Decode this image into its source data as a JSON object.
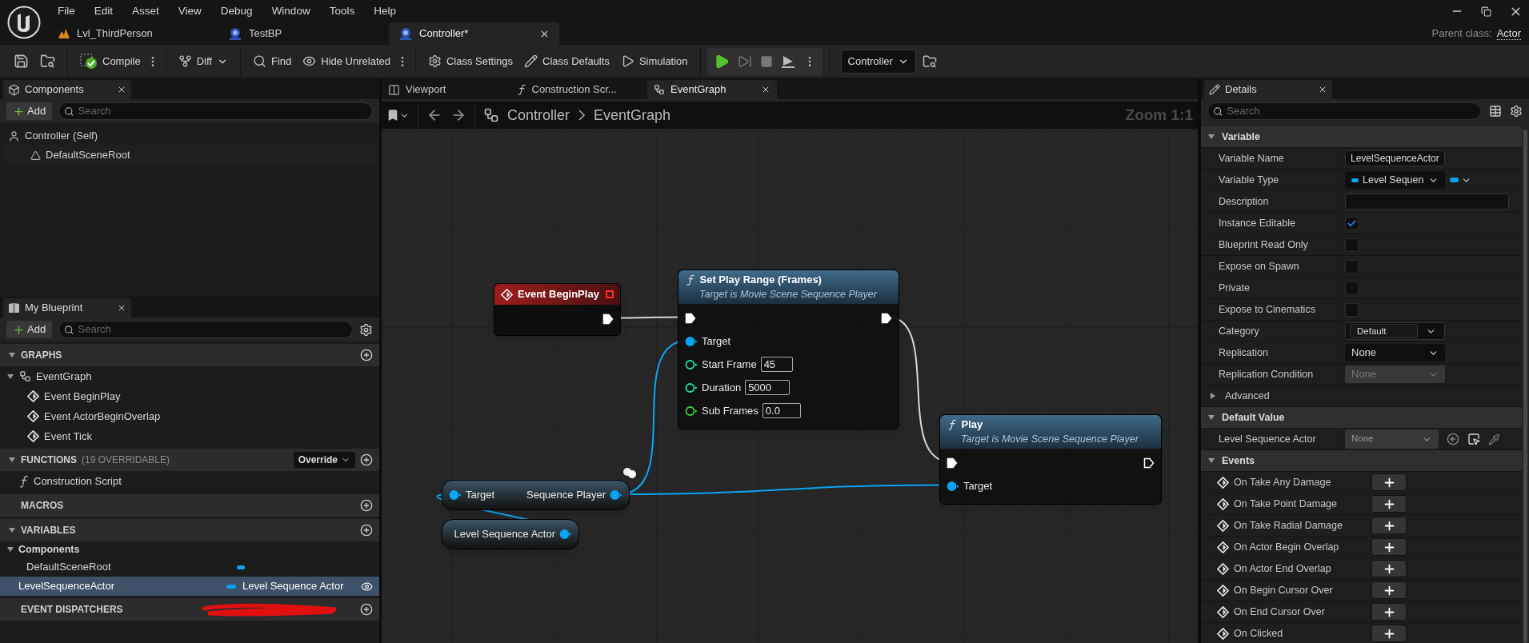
{
  "menu": [
    "File",
    "Edit",
    "Asset",
    "View",
    "Debug",
    "Window",
    "Tools",
    "Help"
  ],
  "document_tabs": [
    {
      "label": "Lvl_ThirdPerson",
      "kind": "level",
      "selected": false
    },
    {
      "label": "TestBP",
      "kind": "blueprint",
      "selected": false
    },
    {
      "label": "Controller*",
      "kind": "blueprint",
      "selected": true
    }
  ],
  "parent_class": {
    "label": "Parent class:",
    "value": "Actor"
  },
  "toolbar": {
    "compile": "Compile",
    "diff": "Diff",
    "find": "Find",
    "hide_unrelated": "Hide Unrelated",
    "class_settings": "Class Settings",
    "class_defaults": "Class Defaults",
    "simulation": "Simulation",
    "debug_object": "Controller"
  },
  "components": {
    "title": "Components",
    "add": "Add",
    "search_placeholder": "Search",
    "tree": [
      {
        "label": "Controller (Self)",
        "children": [
          {
            "label": "DefaultSceneRoot"
          }
        ]
      }
    ]
  },
  "my_blueprint": {
    "title": "My Blueprint",
    "add": "Add",
    "search_placeholder": "Search",
    "graphs": {
      "title": "GRAPHS",
      "expanded": true,
      "items": [
        {
          "label": "EventGraph",
          "expanded": true,
          "children": [
            {
              "label": "Event BeginPlay"
            },
            {
              "label": "Event ActorBeginOverlap"
            },
            {
              "label": "Event Tick"
            }
          ]
        }
      ]
    },
    "functions": {
      "title": "FUNCTIONS",
      "note": "(19 OVERRIDABLE)",
      "override": "Override",
      "expanded": true,
      "items": [
        {
          "label": "Construction Script"
        }
      ]
    },
    "macros": {
      "title": "MACROS"
    },
    "variables": {
      "title": "VARIABLES",
      "expanded": true,
      "categories": [
        {
          "label": "Components",
          "expanded": true,
          "items": [
            {
              "name": "DefaultSceneRoot",
              "selected": false
            }
          ]
        }
      ],
      "items": [
        {
          "name": "LevelSequenceActor",
          "type": "Level Sequence Actor",
          "selected": true
        }
      ]
    },
    "event_dispatchers": {
      "title": "EVENT DISPATCHERS"
    }
  },
  "graph_editor": {
    "tabs": [
      {
        "label": "Viewport",
        "kind": "viewport",
        "selected": false
      },
      {
        "label": "Construction Scr...",
        "kind": "function",
        "selected": false
      },
      {
        "label": "EventGraph",
        "kind": "graph",
        "selected": true
      }
    ],
    "breadcrumb": [
      "Controller",
      "EventGraph"
    ],
    "zoom": "Zoom 1:1",
    "nodes": [
      {
        "kind": "event",
        "title": "Event BeginPlay",
        "outputs": [
          {
            "kind": "exec",
            "connected": true
          }
        ]
      },
      {
        "kind": "function",
        "title": "Set Play Range (Frames)",
        "subtitle": "Target is Movie Scene Sequence Player",
        "inputs": [
          {
            "kind": "exec",
            "connected": true
          },
          {
            "kind": "object",
            "label": "Target",
            "connected": true
          },
          {
            "kind": "int",
            "label": "Start Frame",
            "value": "45",
            "connected": false
          },
          {
            "kind": "int",
            "label": "Duration",
            "value": "5000",
            "connected": false
          },
          {
            "kind": "float",
            "label": "Sub Frames",
            "value": "0.0",
            "connected": false
          }
        ],
        "outputs": [
          {
            "kind": "exec",
            "connected": true
          }
        ]
      },
      {
        "kind": "function",
        "title": "Play",
        "subtitle": "Target is Movie Scene Sequence Player",
        "inputs": [
          {
            "kind": "exec",
            "connected": true
          },
          {
            "kind": "object",
            "label": "Target",
            "connected": true
          }
        ],
        "outputs": [
          {
            "kind": "exec",
            "connected": false
          }
        ]
      },
      {
        "kind": "pure",
        "inputs": [
          {
            "kind": "object",
            "label": "Target",
            "connected": true
          }
        ],
        "outputs": [
          {
            "kind": "object",
            "label": "Sequence Player",
            "connected": true
          }
        ]
      },
      {
        "kind": "getter",
        "outputs": [
          {
            "kind": "object",
            "label": "Level Sequence Actor",
            "connected": true
          }
        ]
      }
    ]
  },
  "details": {
    "title": "Details",
    "search_placeholder": "Search",
    "sections": [
      {
        "title": "Variable",
        "expanded": true,
        "rows": [
          {
            "label": "Variable Name",
            "kind": "text",
            "value": "LevelSequenceActor"
          },
          {
            "label": "Variable Type",
            "kind": "type",
            "value": "Level Sequen"
          },
          {
            "label": "Description",
            "kind": "text"
          },
          {
            "label": "Instance Editable",
            "kind": "checkbox",
            "checked": true
          },
          {
            "label": "Blueprint Read Only",
            "kind": "checkbox",
            "checked": false
          },
          {
            "label": "Expose on Spawn",
            "kind": "checkbox",
            "checked": false
          },
          {
            "label": "Private",
            "kind": "checkbox",
            "checked": false
          },
          {
            "label": "Expose to Cinematics",
            "kind": "checkbox",
            "checked": false
          },
          {
            "label": "Category",
            "kind": "combo",
            "value": "Default"
          },
          {
            "label": "Replication",
            "kind": "dropdown",
            "value": "None",
            "disabled": false
          },
          {
            "label": "Replication Condition",
            "kind": "dropdown",
            "value": "None",
            "disabled": true
          },
          {
            "label": "Advanced",
            "kind": "group",
            "expanded": false
          }
        ]
      },
      {
        "title": "Default Value",
        "expanded": true,
        "rows": [
          {
            "label": "Level Sequence Actor",
            "kind": "asset",
            "value": "None"
          }
        ]
      },
      {
        "title": "Events",
        "expanded": true,
        "rows": [
          {
            "label": "On Take Any Damage",
            "kind": "event"
          },
          {
            "label": "On Take Point Damage",
            "kind": "event"
          },
          {
            "label": "On Take Radial Damage",
            "kind": "event"
          },
          {
            "label": "On Actor Begin Overlap",
            "kind": "event"
          },
          {
            "label": "On Actor End Overlap",
            "kind": "event"
          },
          {
            "label": "On Begin Cursor Over",
            "kind": "event"
          },
          {
            "label": "On End Cursor Over",
            "kind": "event"
          },
          {
            "label": "On Clicked",
            "kind": "event"
          }
        ]
      }
    ]
  }
}
